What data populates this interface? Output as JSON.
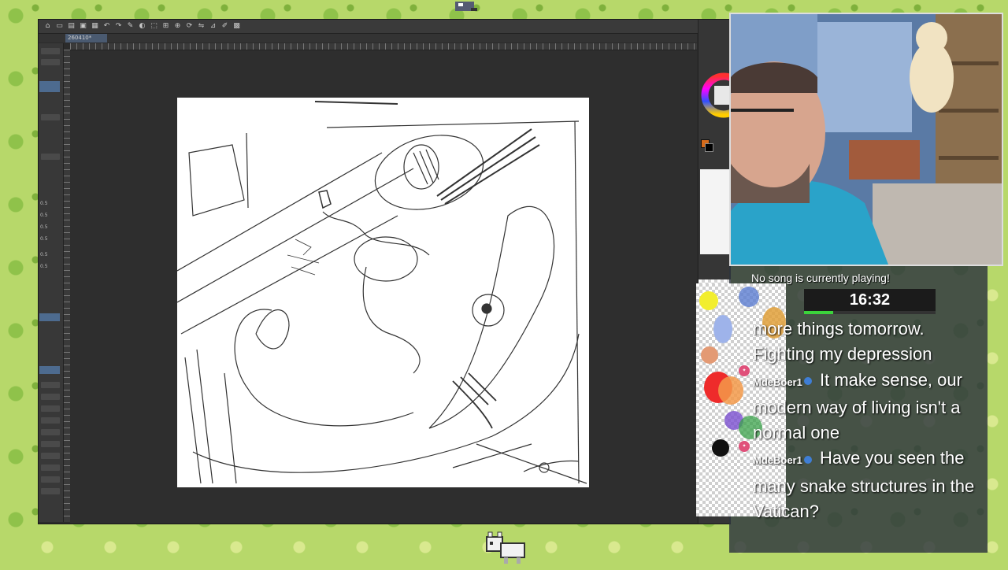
{
  "app": {
    "doc_tab": "260410*",
    "left_panel_rows": [
      "0.5",
      "0.5",
      "0.5",
      "0.5",
      "0.5",
      "0.5"
    ]
  },
  "stream": {
    "now_playing": "No song is currently playing!",
    "timer": "16:32",
    "timer_progress": 0.22,
    "chat": [
      {
        "user": "",
        "text": "more things tomorrow. Fighting my depression"
      },
      {
        "user": "MdeBoer1",
        "text": "It make sense, our modern way of living isn't a normal one"
      },
      {
        "user": "MdeBoer1",
        "text": "Have you seen the many snake structures in the Vatican?"
      }
    ]
  },
  "colors": {
    "accent_orange": "#d46a1a",
    "chat_badge": "#3f7ed6",
    "timer_green": "#3bd33b"
  },
  "icons": [
    "undo-icon",
    "redo-icon",
    "save-icon",
    "brush-icon",
    "eraser-icon",
    "select-icon",
    "zoom-icon",
    "rotate-icon"
  ]
}
